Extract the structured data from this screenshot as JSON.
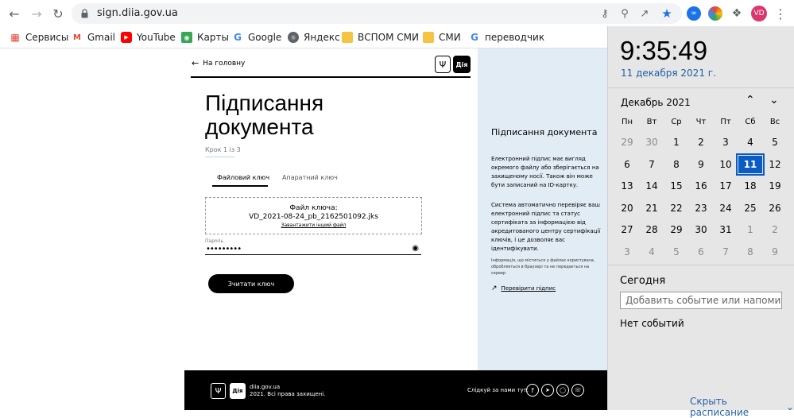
{
  "browser": {
    "url": "sign.diia.gov.ua",
    "avatar_initials": "VD"
  },
  "bookmarks": [
    {
      "label": "Сервисы",
      "icon": "apps-icon"
    },
    {
      "label": "Gmail",
      "icon": "gmail-icon"
    },
    {
      "label": "YouTube",
      "icon": "youtube-icon"
    },
    {
      "label": "Карты",
      "icon": "maps-icon"
    },
    {
      "label": "Google",
      "icon": "google-icon"
    },
    {
      "label": "Яндекс",
      "icon": "globe-icon"
    },
    {
      "label": "ВСПОМ СМИ",
      "icon": "folder-icon"
    },
    {
      "label": "СМИ",
      "icon": "folder-icon"
    },
    {
      "label": "переводчик",
      "icon": "google-icon"
    }
  ],
  "page": {
    "back_link": "На головну",
    "logo_text": "Дія",
    "title_line1": "Підписання",
    "title_line2": "документа",
    "step": "Крок 1 із 3",
    "tabs": [
      "Файловий ключ",
      "Апаратний ключ"
    ],
    "file_key_label": "Файл ключа:",
    "file_name": "VD_2021-08-24_pb_2162501092.jks",
    "upload_other": "Завантажити інший файл",
    "password_label": "Пароль",
    "password_value": "•••••••••",
    "read_key_button": "Зчитати ключ"
  },
  "side": {
    "title": "Підписання документа",
    "para1": "Електронний підпис має вигляд окремого файлу або зберігається на захищеному носії. Також він може бути записаний на ID-картку.",
    "para2": "Система автоматично перевіряє ваш електронний підпис та статус сертифіката за інформацією від акредитованого центру сертифікації ключів, і це дозволяє вас ідентифікувати.",
    "note": "Інформація, що міститься у файлах користувача, обробляється в браузері та не передається на сервер",
    "verify_link": "Перевірити підпис"
  },
  "footer": {
    "site": "diia.gov.ua",
    "rights": "2021. Всі права захищені.",
    "follow": "Слідкуй за нами тут:"
  },
  "clock": {
    "time": "9:35:49",
    "date": "11 декабря 2021 г.",
    "month": "Декабрь 2021",
    "weekdays": [
      "Пн",
      "Вт",
      "Ср",
      "Чт",
      "Пт",
      "Сб",
      "Вс"
    ],
    "days": [
      [
        "29",
        "30",
        "1",
        "2",
        "3",
        "4",
        "5"
      ],
      [
        "6",
        "7",
        "8",
        "9",
        "10",
        "11",
        "12"
      ],
      [
        "13",
        "14",
        "15",
        "16",
        "17",
        "18",
        "19"
      ],
      [
        "20",
        "21",
        "22",
        "23",
        "24",
        "25",
        "26"
      ],
      [
        "27",
        "28",
        "29",
        "30",
        "31",
        "1",
        "2"
      ],
      [
        "3",
        "4",
        "5",
        "6",
        "7",
        "8",
        "9"
      ]
    ],
    "today_label": "Сегодня",
    "event_placeholder": "Добавить событие или напоминание",
    "no_events": "Нет событий",
    "hide_schedule": "Скрыть расписание"
  }
}
